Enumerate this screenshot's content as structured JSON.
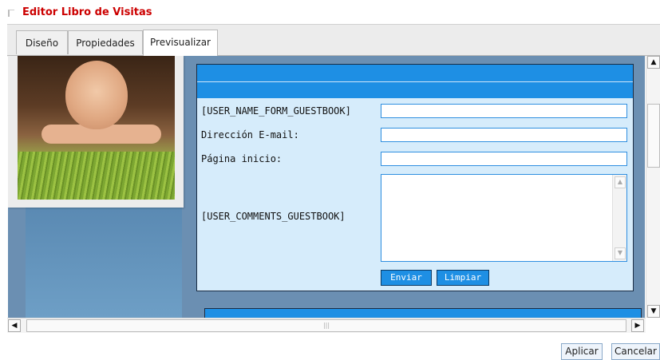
{
  "header": {
    "title": "Editor Libro de Visitas"
  },
  "tabs": [
    {
      "label": "Diseño"
    },
    {
      "label": "Propiedades"
    },
    {
      "label": "Previsualizar"
    }
  ],
  "preview": {
    "form": {
      "fields": [
        {
          "label": "[USER_NAME_FORM_GUESTBOOK]",
          "value": ""
        },
        {
          "label": "Dirección E-mail:",
          "value": ""
        },
        {
          "label": "Página inicio:",
          "value": ""
        },
        {
          "label": "[USER_COMMENTS_GUESTBOOK]",
          "value": ""
        }
      ],
      "submit_label": "Enviar",
      "clear_label": "Limpiar"
    },
    "colors": {
      "panel_header": "#1e8fe4",
      "panel_body": "#d6ecfb",
      "background": "#6b8fb2"
    },
    "image": "woman-lying-on-grass-photo"
  },
  "footer": {
    "apply_label": "Aplicar",
    "cancel_label": "Cancelar"
  },
  "title_color": "#cc0000"
}
